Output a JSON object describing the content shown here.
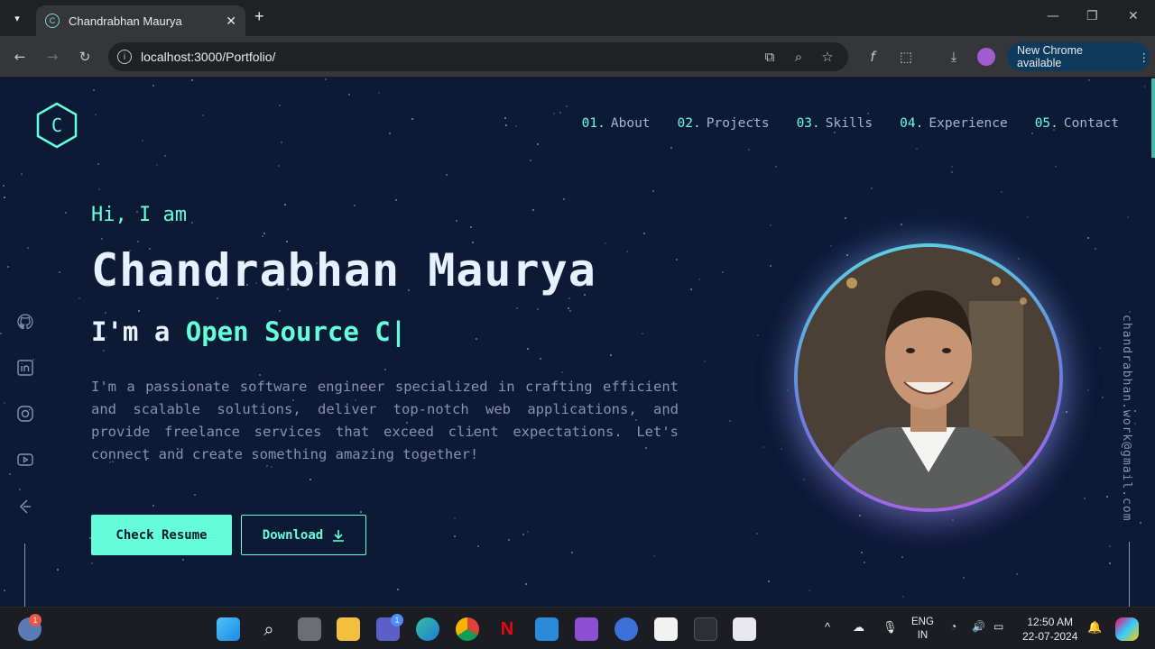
{
  "browser": {
    "tab_title": "Chandrabhan Maurya",
    "tab_favicon": "C",
    "url": "localhost:3000/Portfolio/",
    "new_chrome_label": "New Chrome available"
  },
  "nav": {
    "items": [
      {
        "num": "01.",
        "label": "About"
      },
      {
        "num": "02.",
        "label": "Projects"
      },
      {
        "num": "03.",
        "label": "Skills"
      },
      {
        "num": "04.",
        "label": "Experience"
      },
      {
        "num": "05.",
        "label": "Contact"
      }
    ]
  },
  "logo": {
    "letter": "C"
  },
  "hero": {
    "greeting": "Hi, I am",
    "name": "Chandrabhan Maurya",
    "role_prefix": "I'm a ",
    "role_typed": "Open Source C|",
    "bio": "I'm a passionate software engineer specialized in crafting efficient and scalable solutions, deliver top-notch web applications, and provide freelance services that exceed client expectations. Let's connect and create something amazing together!",
    "resume_button": "Check Resume",
    "download_button": "Download"
  },
  "side": {
    "email": "chandrabhan.work@gmail.com",
    "social_icons": [
      "github-icon",
      "linkedin-icon",
      "instagram-icon",
      "youtube-icon",
      "leetcode-icon"
    ]
  },
  "taskbar": {
    "weather_badge": "1",
    "teams_badge": "1",
    "lang_line1": "ENG",
    "lang_line2": "IN",
    "time": "12:50 AM",
    "date": "22-07-2024"
  },
  "colors": {
    "accent": "#64ffda",
    "background": "#0c1a36",
    "text_muted": "#8892b0"
  }
}
